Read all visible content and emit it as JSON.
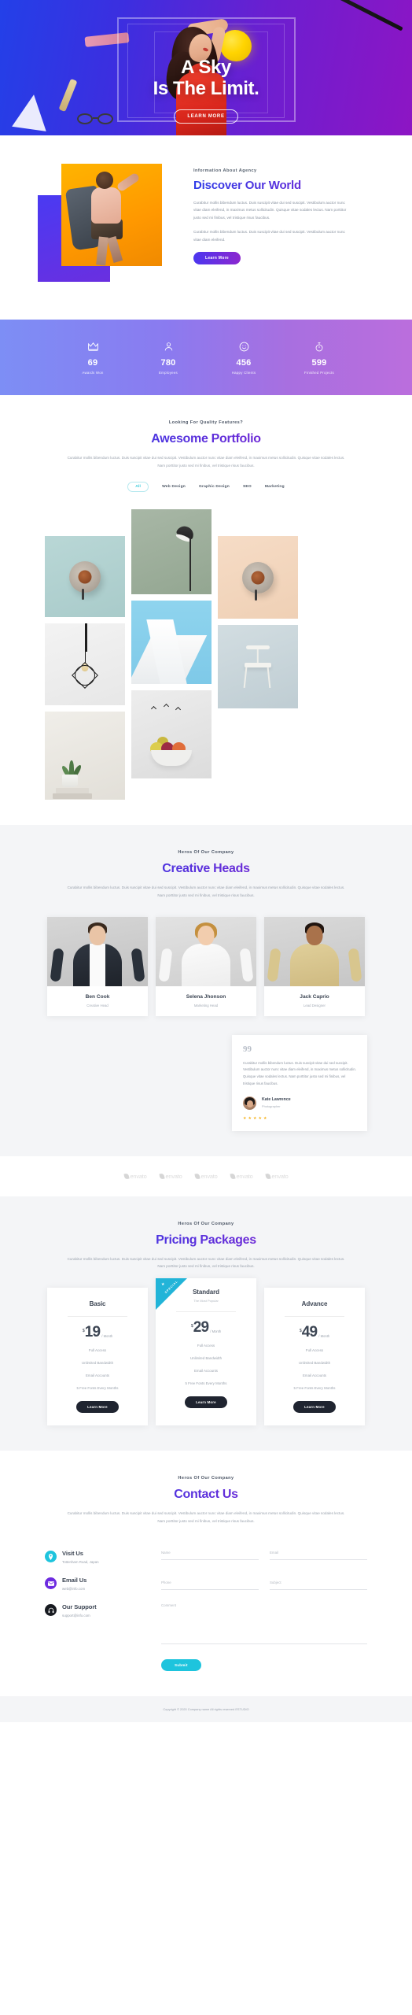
{
  "hero": {
    "title_line1": "A Sky",
    "title_line2": "Is The Limit.",
    "cta": "LEARN MORE"
  },
  "discover": {
    "eyebrow": "Information About Agency",
    "heading": "Discover Our World",
    "paragraph1": "Curabitur mollis bibendum luctus. Duis suscipit vitae dui sed suscipit. Vestibulum auctor nunc vitae diam eleifend, in maximus metus sollicitudin. Quisque vitae sodales lectus. Nam porttitor justo sed mi finibus, vel tristique risus faucibus.",
    "paragraph2": "Curabitur mollis bibendum luctus. Duis suscipit vitae dui sed suscipit. Vestibulum auctor nunc vitae diam eleifend.",
    "button": "Learn More"
  },
  "stats": [
    {
      "icon": "crown-icon",
      "value": "69",
      "label": "Awards Won"
    },
    {
      "icon": "user-icon",
      "value": "780",
      "label": "Employees"
    },
    {
      "icon": "smile-icon",
      "value": "456",
      "label": "Happy Clients"
    },
    {
      "icon": "stopwatch-icon",
      "value": "599",
      "label": "Finished Projects"
    }
  ],
  "portfolio": {
    "eyebrow": "Looking For Quality Features?",
    "heading": "Awesome Portfolio",
    "paragraph": "Curabitur mollis bibendum luctus. Duis suscipit vitae dui sed suscipit. Vestibulum auctor nunc vitae diam eleifend, in maximus metus sollicitudin. Quisque vitae sodales lectus. Nam porttitor justo sed mi finibus, vel tristique risus faucibus.",
    "filters": [
      "All",
      "Web Design",
      "Graphic Design",
      "SEO",
      "Marketing"
    ],
    "active_filter": "All"
  },
  "team": {
    "eyebrow": "Heros Of Our Company",
    "heading": "Creative Heads",
    "paragraph": "Curabitur mollis bibendum luctus. Duis suscipit vitae dui sed suscipit. Vestibulum auctor nunc vitae diam eleifend, in maximus metus sollicitudin. Quisque vitae sodales lectus. Nam porttitor justo sed mi finibus, vel tristique risus faucibus.",
    "members": [
      {
        "name": "Ben Cook",
        "role": "Creative Head"
      },
      {
        "name": "Selena Jhonson",
        "role": "Marketing Head"
      },
      {
        "name": "Jack Caprio",
        "role": "Lead Designer"
      }
    ]
  },
  "testimonial": {
    "quote_mark": "99",
    "text": "Curabitur mollis bibendum luctus. Duis suscipit vitae dui sed suscipit. Vestibulum auctor nunc vitae diam eleifend, in maximus metus sollicitudin. Quisque vitae sodales lectus. Nam porttitor justo sed mi finibus, vel tristique risus faucibus.",
    "author": "Kate Lawrence",
    "role": "Photographer",
    "rating": 5
  },
  "brands": [
    {
      "name": "envato"
    },
    {
      "name": "envato"
    },
    {
      "name": "envato"
    },
    {
      "name": "envato"
    },
    {
      "name": "envato"
    }
  ],
  "pricing": {
    "eyebrow": "Heros Of Our Company",
    "heading": "Pricing Packages",
    "paragraph": "Curabitur mollis bibendum luctus. Duis suscipit vitae dui sed suscipit. Vestibulum auctor nunc vitae diam eleifend, in maximus metus sollicitudin. Quisque vitae sodales lectus. Nam porttitor justo sed mi finibus, vel tristique risus faucibus.",
    "plans": [
      {
        "name": "Basic",
        "subtitle": "",
        "currency": "$",
        "amount": "19",
        "period": "/ Month",
        "features": [
          "Full Access",
          "Unlimited Bandwidth",
          "Email Accounts",
          "5 Free Fonts Every Months"
        ],
        "button": "Learn More",
        "ribbon": ""
      },
      {
        "name": "Standard",
        "subtitle": "The Most Popular",
        "currency": "$",
        "amount": "29",
        "period": "/ Month",
        "features": [
          "Full Access",
          "Unlimited Bandwidth",
          "Email Accounts",
          "5 Free Fonts Every Months"
        ],
        "button": "Learn More",
        "ribbon": "SPECIAL"
      },
      {
        "name": "Advance",
        "subtitle": "",
        "currency": "$",
        "amount": "49",
        "period": "/ Month",
        "features": [
          "Full Access",
          "Unlimited Bandwidth",
          "Email Accounts",
          "5 Free Fonts Every Months"
        ],
        "button": "Learn More",
        "ribbon": ""
      }
    ]
  },
  "contact": {
    "eyebrow": "Heros Of Our Company",
    "heading": "Contact Us",
    "paragraph": "Curabitur mollis bibendum luctus. Duis suscipit vitae dui sed suscipit. Vestibulum auctor nunc vitae diam eleifend, in maximus metus sollicitudin. Quisque vitae sodales lectus. Nam porttitor justo sed mi finibus, vel tristique risus faucibus.",
    "info": [
      {
        "icon": "location-pin-icon",
        "title": "Visit Us",
        "detail": "Tottenham Road, Japan",
        "color": "#1ec4dd"
      },
      {
        "icon": "envelope-icon",
        "title": "Email Us",
        "detail": "web@info.com",
        "color": "#6d2be0"
      },
      {
        "icon": "headset-icon",
        "title": "Our Support",
        "detail": "support@info.com",
        "color": "#171a20"
      }
    ],
    "fields": {
      "name_placeholder": "Name",
      "email_placeholder": "Email",
      "phone_placeholder": "Phone",
      "subject_placeholder": "Subject",
      "comment_placeholder": "Comment",
      "name_value": "",
      "email_value": "",
      "phone_value": "",
      "subject_value": "",
      "comment_value": ""
    },
    "submit": "Submit"
  },
  "footer": {
    "text": "Copyright © 2020 Company name All rights reserved ESTUDIO"
  },
  "colors": {
    "brand_blue": "#2f3ce8",
    "brand_purple": "#8a23cf",
    "cyan": "#1ec4dd",
    "dark": "#1f2430"
  }
}
